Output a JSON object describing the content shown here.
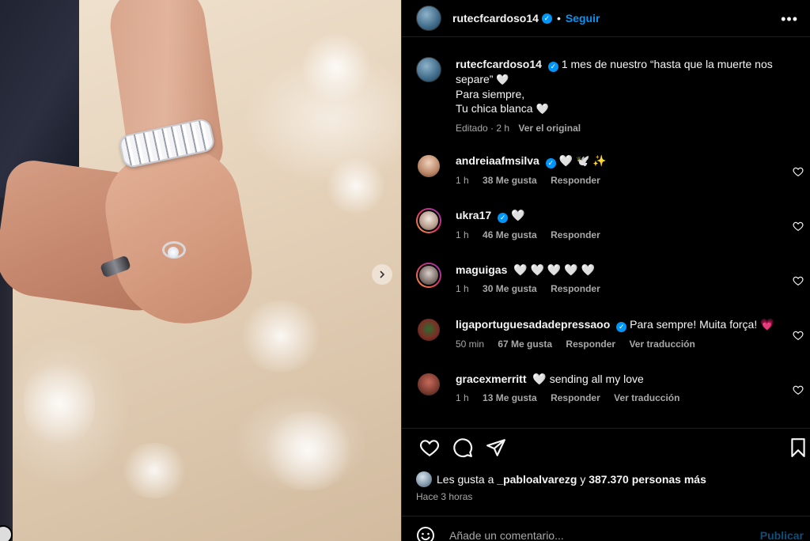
{
  "post": {
    "author": "rutecfcardoso14",
    "follow_label": "Seguir",
    "dot": "•",
    "more_label": "•••",
    "caption_line1": "1 mes de nuestro “hasta que la muerte nos separe”",
    "caption_line2": "Para siempre,",
    "caption_line3": "Tu chica blanca",
    "heart": "🤍",
    "edited": "Editado · 2 h",
    "see_original": "Ver el original"
  },
  "comments": [
    {
      "user": "andreiaafmsilva",
      "verified": true,
      "text": "🤍 🕊️ ✨",
      "time": "1 h",
      "likes": "38 Me gusta",
      "reply": "Responder",
      "translate": "",
      "avatar_color": "#c9a58a"
    },
    {
      "user": "ukra17",
      "verified": true,
      "text": "🤍",
      "time": "1 h",
      "likes": "46 Me gusta",
      "reply": "Responder",
      "translate": "",
      "avatar_color": "#d8c4b6"
    },
    {
      "user": "maguigas",
      "verified": false,
      "text": "🤍 🤍 🤍 🤍 🤍",
      "time": "1 h",
      "likes": "30 Me gusta",
      "reply": "Responder",
      "translate": "",
      "avatar_color": "#8a7b76"
    },
    {
      "user": "ligaportuguesadadepressaoo",
      "verified": true,
      "text": "Para sempre! Muita força! 💗",
      "time": "50 min",
      "likes": "67 Me gusta",
      "reply": "Responder",
      "translate": "Ver traducción",
      "avatar_color": "#6d3a2e"
    },
    {
      "user": "gracexmerritt",
      "verified": false,
      "text": "🤍 sending all my love",
      "time": "1 h",
      "likes": "13 Me gusta",
      "reply": "Responder",
      "translate": "Ver traducción",
      "avatar_color": "#7a3b2f"
    }
  ],
  "likes": {
    "prefix": "Les gusta a",
    "who": "_pabloalvarezg",
    "connector": "y",
    "count": "387.370 personas más"
  },
  "time_ago": "Hace 3 horas",
  "composer": {
    "placeholder": "Añade un comentario...",
    "publish": "Publicar"
  },
  "colors": {
    "accent": "#0095f6",
    "muted": "#a8a8a8",
    "background": "#000000"
  },
  "icons": [
    "chevron-right-icon",
    "more-icon",
    "verified-icon",
    "heart-icon",
    "comment-icon",
    "share-icon",
    "bookmark-icon",
    "emoji-icon"
  ]
}
